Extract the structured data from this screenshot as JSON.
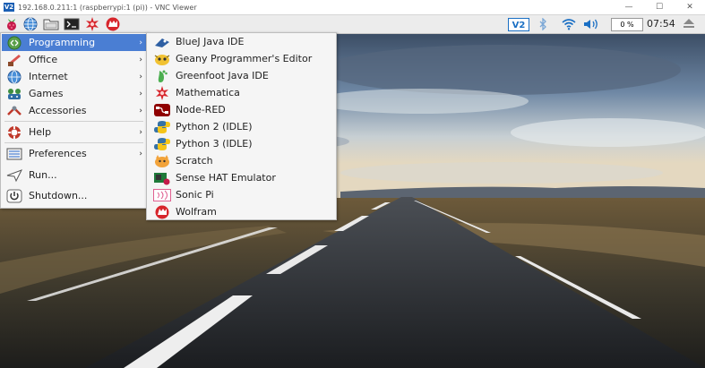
{
  "window": {
    "title": "192.168.0.211:1 (raspberrypi:1 (pi)) - VNC Viewer",
    "logo_text": "V2",
    "minimize": "—",
    "maximize": "☐",
    "close": "✕"
  },
  "taskbar": {
    "vnc_badge": "V2",
    "cpu": "0 %",
    "clock": "07:54"
  },
  "main_menu": {
    "items": [
      {
        "label": "Programming",
        "icon": "programming-icon",
        "submenu": true
      },
      {
        "label": "Office",
        "icon": "office-icon",
        "submenu": true
      },
      {
        "label": "Internet",
        "icon": "globe-icon",
        "submenu": true
      },
      {
        "label": "Games",
        "icon": "games-icon",
        "submenu": true
      },
      {
        "label": "Accessories",
        "icon": "accessories-icon",
        "submenu": true
      },
      {
        "label": "Help",
        "icon": "help-icon",
        "submenu": true
      },
      {
        "label": "Preferences",
        "icon": "preferences-icon",
        "submenu": true
      },
      {
        "label": "Run...",
        "icon": "run-icon",
        "submenu": false
      },
      {
        "label": "Shutdown...",
        "icon": "shutdown-icon",
        "submenu": false
      }
    ],
    "arrow": "›"
  },
  "programming_menu": {
    "items": [
      {
        "label": "BlueJ Java IDE",
        "icon": "bluej-icon"
      },
      {
        "label": "Geany Programmer's Editor",
        "icon": "geany-icon"
      },
      {
        "label": "Greenfoot Java IDE",
        "icon": "greenfoot-icon"
      },
      {
        "label": "Mathematica",
        "icon": "mathematica-icon"
      },
      {
        "label": "Node-RED",
        "icon": "node-red-icon"
      },
      {
        "label": "Python 2 (IDLE)",
        "icon": "python-icon"
      },
      {
        "label": "Python 3 (IDLE)",
        "icon": "python-icon"
      },
      {
        "label": "Scratch",
        "icon": "scratch-icon"
      },
      {
        "label": "Sense HAT Emulator",
        "icon": "sense-hat-icon"
      },
      {
        "label": "Sonic Pi",
        "icon": "sonic-pi-icon"
      },
      {
        "label": "Wolfram",
        "icon": "wolfram-icon"
      }
    ]
  },
  "colors": {
    "menu_highlight": "#4a7ed3",
    "menu_bg": "#f5f5f5",
    "taskbar_bg": "#ececec"
  }
}
